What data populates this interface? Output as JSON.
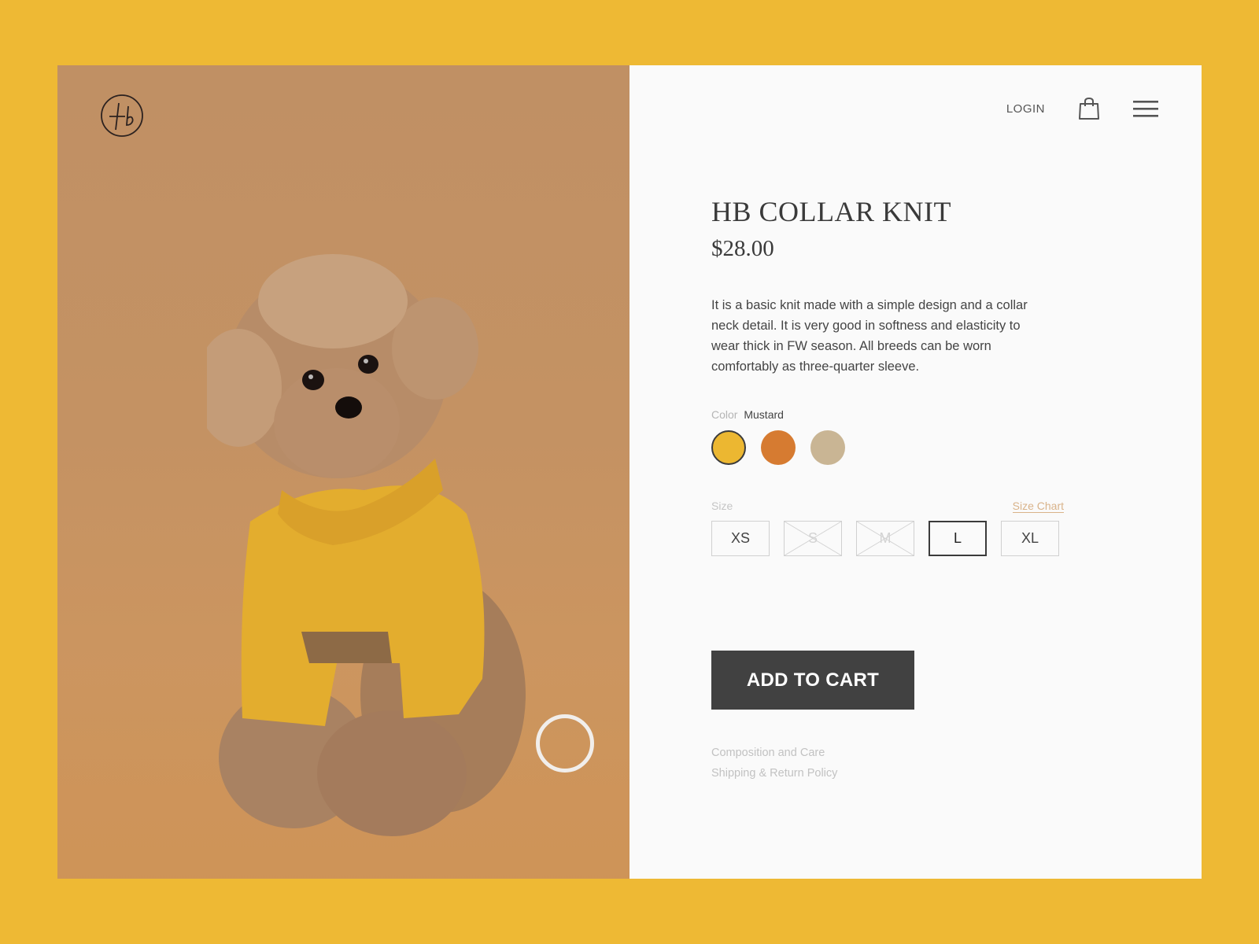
{
  "brand": {
    "logo_text": "Hb"
  },
  "nav": {
    "login_label": "LOGIN",
    "cart_icon": "shopping-bag-icon",
    "menu_icon": "hamburger-menu-icon"
  },
  "product": {
    "title": "HB COLLAR KNIT",
    "price": "$28.00",
    "description": "It is a basic knit made with a simple design and a collar neck detail.  It is very good in softness and elasticity to wear thick in FW season. All breeds can be worn comfortably as three-quarter sleeve.",
    "color": {
      "label": "Color",
      "selected": "Mustard",
      "options": [
        {
          "name": "Mustard",
          "hex": "#ecb731",
          "selected": true
        },
        {
          "name": "Orange",
          "hex": "#d67b31",
          "selected": false
        },
        {
          "name": "Beige",
          "hex": "#c9b594",
          "selected": false
        }
      ]
    },
    "size": {
      "label": "Size",
      "chart_link": "Size Chart",
      "options": [
        {
          "label": "XS",
          "available": true,
          "selected": false
        },
        {
          "label": "S",
          "available": false,
          "selected": false
        },
        {
          "label": "M",
          "available": false,
          "selected": false
        },
        {
          "label": "L",
          "available": true,
          "selected": true
        },
        {
          "label": "XL",
          "available": true,
          "selected": false
        }
      ]
    },
    "add_to_cart_label": "ADD TO CART",
    "links": [
      "Composition and Care",
      "Shipping & Return Policy"
    ]
  },
  "colors": {
    "background": "#eeb934",
    "button": "#414141",
    "accent_link": "#d9b38a"
  }
}
